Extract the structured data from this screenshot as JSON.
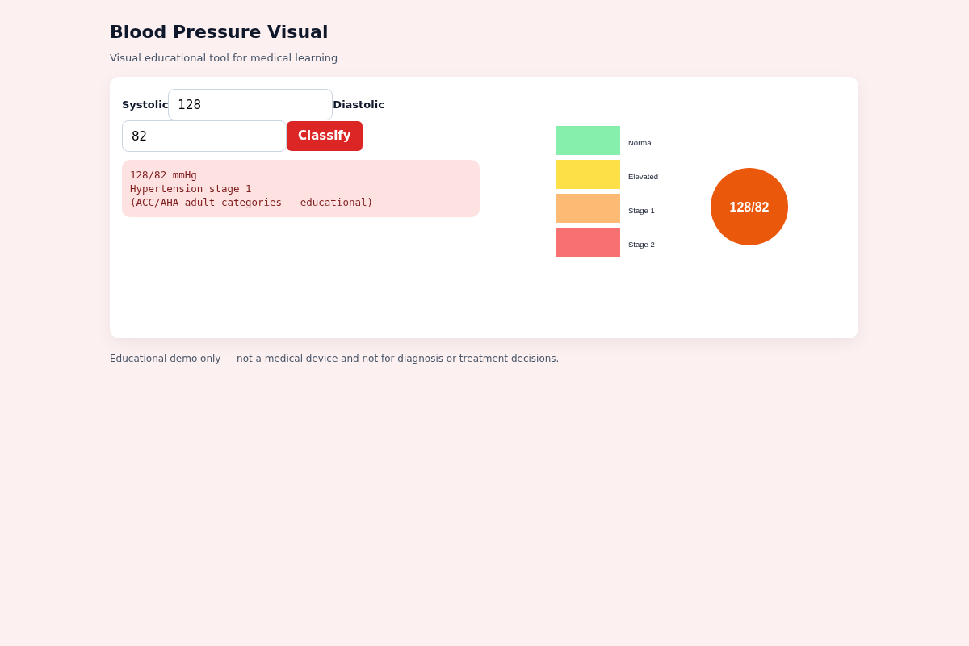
{
  "header": {
    "title": "Blood Pressure Visual",
    "subtitle": "Visual educational tool for medical learning"
  },
  "form": {
    "systolic": {
      "label": "Systolic",
      "value": "128"
    },
    "diastolic": {
      "label": "Diastolic",
      "value": "82"
    },
    "button": "Classify"
  },
  "result": {
    "lines": [
      "128/82 mmHg",
      "Hypertension stage 1",
      "(ACC/AHA adult categories — educational)"
    ]
  },
  "legend": [
    {
      "label": "Normal",
      "color": "#86efac"
    },
    {
      "label": "Elevated",
      "color": "#fde047"
    },
    {
      "label": "Stage 1",
      "color": "#fdba74"
    },
    {
      "label": "Stage 2",
      "color": "#f87171"
    }
  ],
  "indicator": {
    "text": "128/82",
    "color": "#ea580c"
  },
  "footer": "Educational demo only — not a medical device and not for diagnosis or treatment decisions."
}
